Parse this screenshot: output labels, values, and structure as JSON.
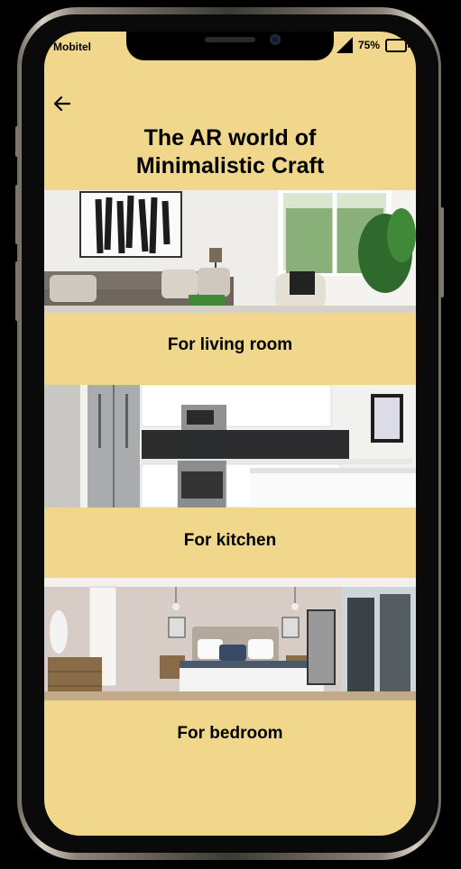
{
  "status_bar": {
    "carrier": "Mobitel",
    "battery": "75%"
  },
  "header": {
    "title_line1": "The AR world of",
    "title_line2": "Minimalistic Craft"
  },
  "cards": [
    {
      "label": "For living room",
      "image": "living-room-photo"
    },
    {
      "label": "For kitchen",
      "image": "kitchen-photo"
    },
    {
      "label": "For bedroom",
      "image": "bedroom-photo"
    }
  ],
  "colors": {
    "screen_background": "#f0d78c",
    "text": "#000000"
  },
  "icons": [
    "arrow-left-icon",
    "signal-icon",
    "battery-icon"
  ]
}
